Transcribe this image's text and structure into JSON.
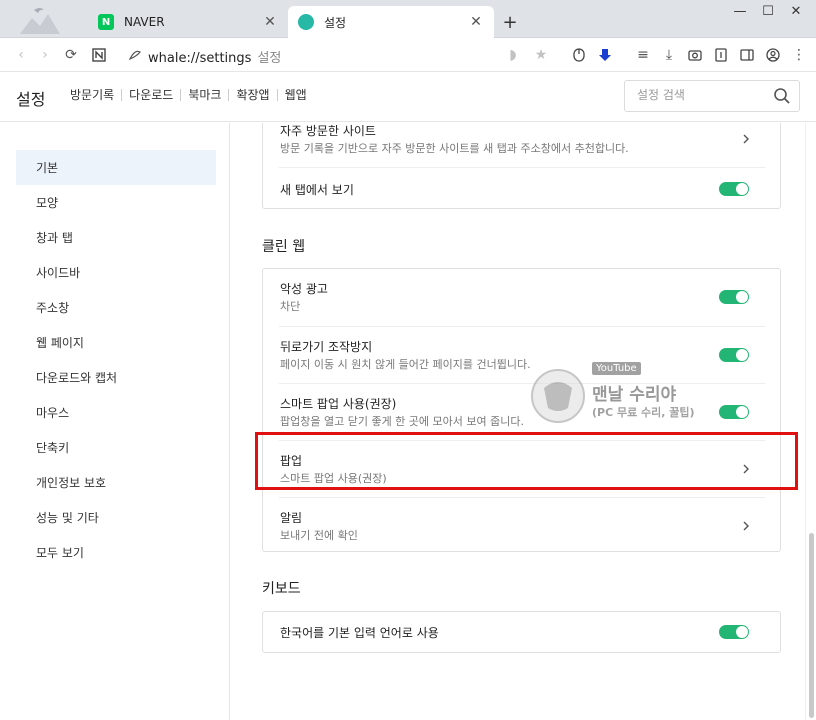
{
  "tabs": [
    {
      "title": "NAVER",
      "favicon_text": "N",
      "favicon_color": "#03c75a",
      "active": false
    },
    {
      "title": "설정",
      "favicon_text": "",
      "favicon_color": "#27b8a6",
      "active": true
    }
  ],
  "toolbar": {
    "url": "whale://settings",
    "url_page": "설정"
  },
  "header": {
    "title": "설정",
    "nav": [
      "방문기록",
      "다운로드",
      "북마크",
      "확장앱",
      "웹앱"
    ],
    "search_placeholder": "설정 검색"
  },
  "sidebar": {
    "items": [
      "기본",
      "모양",
      "창과 탭",
      "사이드바",
      "주소창",
      "웹 페이지",
      "다운로드와 캡처",
      "마우스",
      "단축키",
      "개인정보 보호",
      "성능 및 기타",
      "모두 보기"
    ],
    "active_index": 0
  },
  "main": {
    "card1": {
      "rows": [
        {
          "label": "자주 방문한 사이트",
          "desc": "방문 기록을 기반으로 자주 방문한 사이트를 새 탭과 주소창에서 추천합니다."
        },
        {
          "label": "새 탭에서 보기"
        }
      ]
    },
    "section_clean": "클린 웹",
    "card2": {
      "rows": [
        {
          "label": "악성 광고",
          "desc": "차단"
        },
        {
          "label": "뒤로가기 조작방지",
          "desc": "페이지 이동 시 원치 않게 들어간 페이지를 건너뜁니다."
        },
        {
          "label": "스마트 팝업 사용(권장)",
          "desc": "팝업창을 열고 닫기 좋게 한 곳에 모아서 보여 줍니다."
        },
        {
          "label": "팝업",
          "desc": "스마트 팝업 사용(권장)"
        },
        {
          "label": "알림",
          "desc": "보내기 전에 확인"
        }
      ]
    },
    "section_keyboard": "키보드",
    "card3": {
      "rows": [
        {
          "label": "한국어를 기본 입력 언어로 사용"
        }
      ]
    }
  },
  "watermark": {
    "badge": "YouTube",
    "title": "맨날 수리야",
    "subtitle": "(PC 무료 수리, 꿀팁)"
  },
  "colors": {
    "toggle_on": "#22b573",
    "highlight": "#e01010",
    "sidebar_active": "#ecf3fb"
  }
}
